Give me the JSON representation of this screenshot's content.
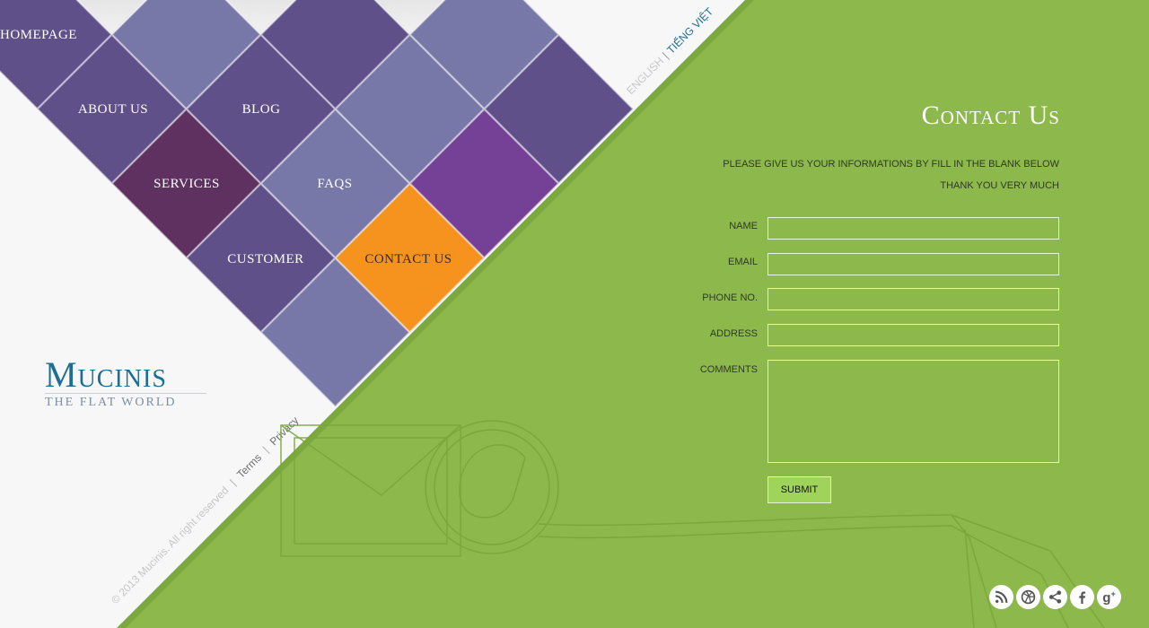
{
  "language": {
    "english": "ENGLISH",
    "separator": "|",
    "vietnamese": "TIẾNG VIỆT"
  },
  "menu": [
    {
      "id": "homepage",
      "label": "HOMEPAGE"
    },
    {
      "id": "about-us",
      "label": "ABOUT US"
    },
    {
      "id": "blog",
      "label": "BLOG"
    },
    {
      "id": "services",
      "label": "SERVICES"
    },
    {
      "id": "faqs",
      "label": "FAQS"
    },
    {
      "id": "customer",
      "label": "CUSTOMER"
    },
    {
      "id": "contact-us",
      "label": "CONTACT US",
      "active": true
    }
  ],
  "logo": {
    "title": "Mucinis",
    "subtitle": "THE FLAT WORLD"
  },
  "footer": {
    "copyright": "© 2013 Mucinis. All right reserved",
    "separator": "|",
    "terms": "Terms",
    "privacy": "Privacy"
  },
  "contact": {
    "title": "Contact Us",
    "intro_line1": "PLEASE GIVE US YOUR INFORMATIONS BY FILL IN THE BLANK BELOW",
    "intro_line2": "THANK YOU VERY MUCH",
    "fields": {
      "name": {
        "label": "NAME",
        "value": ""
      },
      "email": {
        "label": "EMAIL",
        "value": ""
      },
      "phone": {
        "label": "PHONE NO.",
        "value": ""
      },
      "address": {
        "label": "ADDRESS",
        "value": ""
      },
      "comments": {
        "label": "COMMENTS",
        "value": ""
      }
    },
    "submit_label": "SUBMIT"
  },
  "social": [
    {
      "icon": "rss-icon"
    },
    {
      "icon": "dribbble-icon"
    },
    {
      "icon": "share-icon"
    },
    {
      "icon": "facebook-icon"
    },
    {
      "icon": "google-plus-icon"
    }
  ],
  "colors": {
    "background_green": "#8cb84c",
    "dark_purple": "#5f5089",
    "light_purple": "#7778a7",
    "wine": "#5e3160",
    "purple": "#754197",
    "orange": "#f6931f",
    "logo_blue": "#1d6e95"
  }
}
